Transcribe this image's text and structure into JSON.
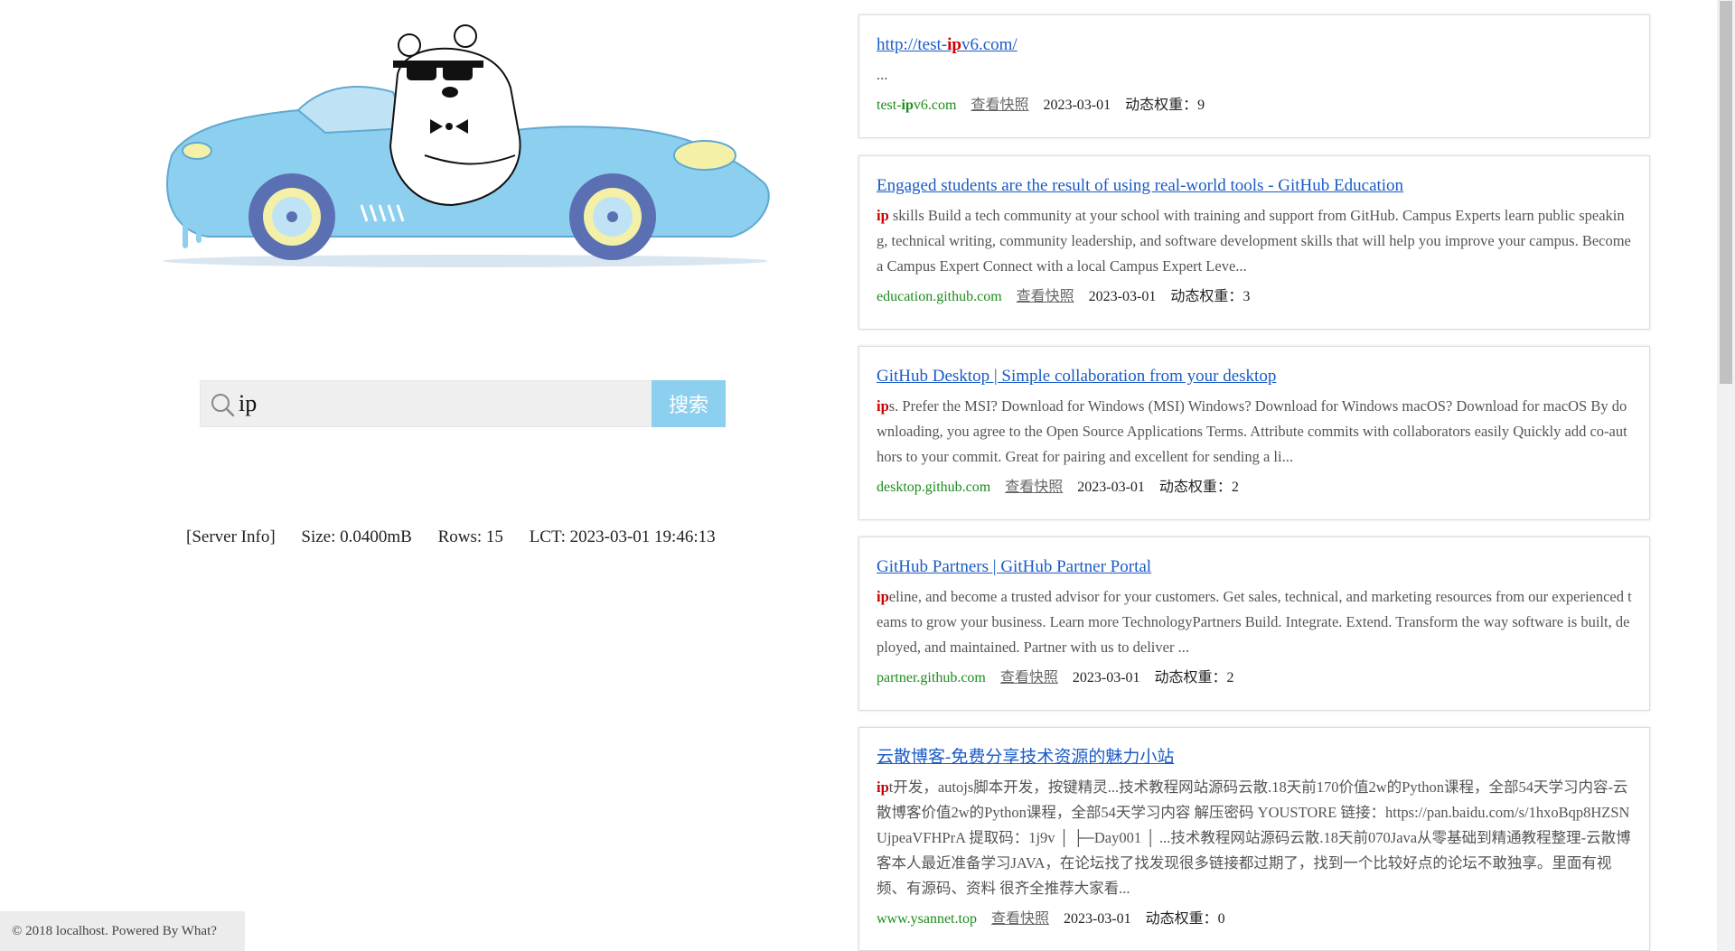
{
  "search": {
    "value": "ip",
    "button_label": "搜索"
  },
  "server_info": {
    "label": "[Server Info]",
    "size": "Size: 0.0400mB",
    "rows": "Rows: 15",
    "lct": "LCT: 2023-03-01 19:46:13"
  },
  "footer": {
    "text": "© 2018 localhost. Powered By What?"
  },
  "snapshot_label": "查看快照",
  "colors": {
    "accent": "#8dcfee",
    "link": "#1a5bc6",
    "highlight": "#cc0000",
    "domain": "#1d8b1d"
  },
  "results": [
    {
      "title_pre": "http://test-",
      "title_hl": "ip",
      "title_post": "v6.com/",
      "snippet_hl": "",
      "snippet": "...",
      "domain_pre": "test-",
      "domain_hl": "ip",
      "domain_post": "v6.com",
      "snapshot": "查看快照",
      "date": "2023-03-01",
      "weight": "动态权重：9"
    },
    {
      "title_pre": "Engaged students are the result of using real-world tools - GitHub Education",
      "title_hl": "",
      "title_post": "",
      "snippet_hl": "ip",
      "snippet": " skills Build a tech community at your school with training and support from GitHub. Campus Experts learn public speaking, technical writing, community leadership, and software development skills that will help you improve your campus. Become a Campus Expert Connect with a local Campus Expert Leve...",
      "domain_pre": "education.github.com",
      "domain_hl": "",
      "domain_post": "",
      "snapshot": "查看快照",
      "date": "2023-03-01",
      "weight": "动态权重：3"
    },
    {
      "title_pre": "GitHub Desktop | Simple collaboration from your desktop",
      "title_hl": "",
      "title_post": "",
      "snippet_hl": "ip",
      "snippet": "s. Prefer the MSI? Download for Windows (MSI) Windows? Download for Windows macOS? Download for macOS By downloading, you agree to the Open Source Applications Terms. Attribute commits with collaborators easily Quickly add co-authors to your commit. Great for pairing and excellent for sending a li...",
      "domain_pre": "desktop.github.com",
      "domain_hl": "",
      "domain_post": "",
      "snapshot": "查看快照",
      "date": "2023-03-01",
      "weight": "动态权重：2"
    },
    {
      "title_pre": "GitHub Partners | GitHub Partner Portal",
      "title_hl": "",
      "title_post": "",
      "snippet_hl": "ip",
      "snippet": "eline, and become a trusted advisor for your customers. Get sales, technical, and marketing resources from our experienced teams to grow your business. Learn more TechnologyPartners Build. Integrate. Extend. Transform the way software is built, deployed, and maintained. Partner with us to deliver ...",
      "domain_pre": "partner.github.com",
      "domain_hl": "",
      "domain_post": "",
      "snapshot": "查看快照",
      "date": "2023-03-01",
      "weight": "动态权重：2"
    },
    {
      "title_pre": "云散博客-免费分享技术资源的魅力小站",
      "title_hl": "",
      "title_post": "",
      "snippet_hl": "ip",
      "snippet": "t开发，autojs脚本开发，按键精灵...技术教程网站源码云散.18天前170价值2w的Python课程，全部54天学习内容-云散博客价值2w的Python课程，全部54天学习内容 解压密码 YOUSTORE 链接：https://pan.baidu.com/s/1hxoBqp8HZSNUjpeaVFHPrA 提取码：1j9v │ ├─Day001 │ ...技术教程网站源码云散.18天前070Java从零基础到精通教程整理-云散博客本人最近准备学习JAVA，在论坛找了找发现很多链接都过期了，找到一个比较好点的论坛不敢独享。里面有视频、有源码、资料 很齐全推荐大家看...",
      "domain_pre": "www.ysannet.top",
      "domain_hl": "",
      "domain_post": "",
      "snapshot": "查看快照",
      "date": "2023-03-01",
      "weight": "动态权重：0"
    }
  ]
}
